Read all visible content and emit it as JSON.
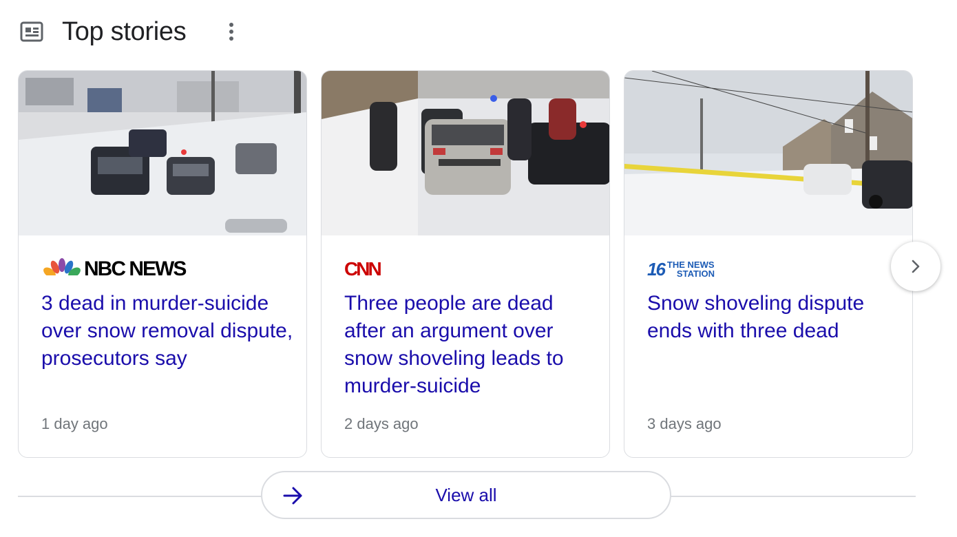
{
  "header": {
    "icon": "news-icon",
    "title": "Top stories",
    "menu_icon": "more-vert-icon"
  },
  "stories": [
    {
      "source": "NBC NEWS",
      "source_logo": "nbc-peacock-icon",
      "headline": "3 dead in murder-suicide over snow removal dispute, prosecutors say",
      "age": "1 day ago"
    },
    {
      "source": "CNN",
      "source_logo": "cnn-logo",
      "headline": "Three people are dead after an argument over snow shoveling leads to murder-suicide",
      "age": "2 days ago"
    },
    {
      "source": "THE NEWS STATION",
      "source_logo": "news-station-16-logo",
      "source_line1": "THE NEWS",
      "source_line2": "STATION",
      "source_channel": "16",
      "headline": "Snow shoveling dispute ends with three dead",
      "age": "3 days ago"
    }
  ],
  "carousel": {
    "next_icon": "chevron-right-icon"
  },
  "footer": {
    "view_all_label": "View all",
    "arrow_icon": "arrow-right-icon"
  },
  "colors": {
    "link": "#1a0dab",
    "meta": "#70757a",
    "title": "#202124",
    "border": "#dadce0",
    "cnn_red": "#cc0000",
    "news_station_blue": "#1c5bb5"
  }
}
